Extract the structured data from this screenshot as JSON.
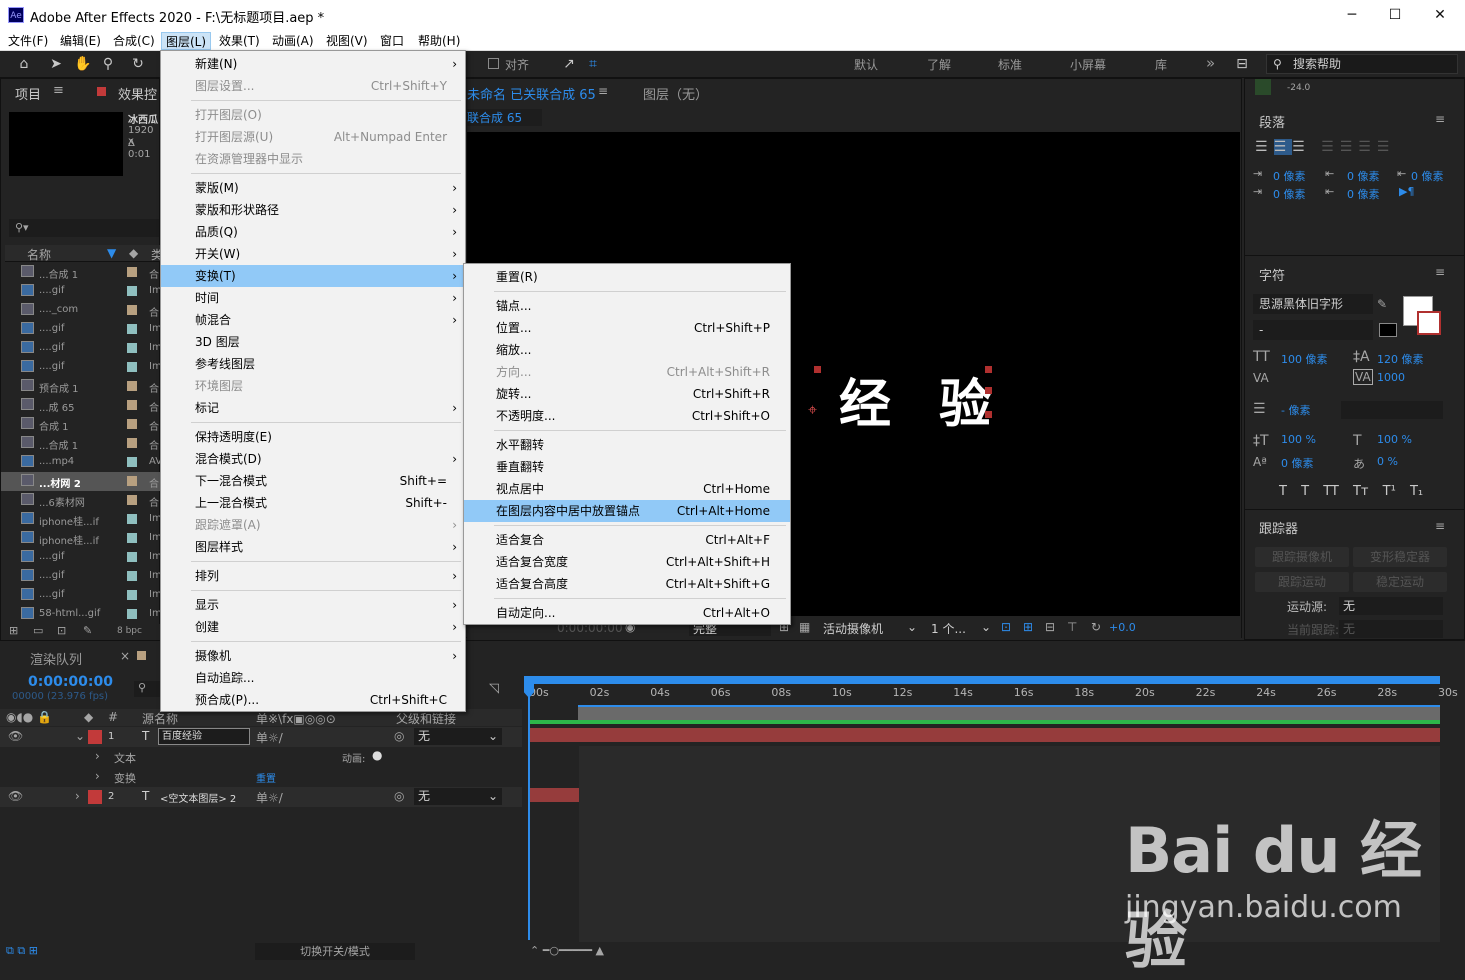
{
  "window": {
    "title": "Adobe After Effects 2020 - F:\\无标题项目.aep *",
    "app_icon": "Ae",
    "controls": {
      "minimize": "─",
      "maximize": "☐",
      "close": "✕"
    }
  },
  "menubar": [
    "文件(F)",
    "编辑(E)",
    "合成(C)",
    "图层(L)",
    "效果(T)",
    "动画(A)",
    "视图(V)",
    "窗口",
    "帮助(H)"
  ],
  "toolbar": {
    "align_label": "对齐",
    "workspaces": [
      "默认",
      "了解",
      "标准",
      "小屏幕",
      "库"
    ],
    "more": "»",
    "search_placeholder": "搜索帮助"
  },
  "project_panel": {
    "title": "项目",
    "effects_tab": "效果控",
    "comp_name": "冰西瓜",
    "comp_size": "1920 x",
    "comp_duration": "Δ 0:01",
    "col_name": "名称",
    "col_type": "类",
    "items": [
      {
        "name": "...合成 1",
        "type": "合"
      },
      {
        "name": "....gif",
        "type": "Im"
      },
      {
        "name": "...._com",
        "type": "合"
      },
      {
        "name": "....gif",
        "type": "Im"
      },
      {
        "name": "....gif",
        "type": "Im"
      },
      {
        "name": "....gif",
        "type": "Im"
      },
      {
        "name": "预合成 1",
        "type": "合"
      },
      {
        "name": "...成 65",
        "type": "合"
      },
      {
        "name": "合成 1",
        "type": "合"
      },
      {
        "name": "...合成 1",
        "type": "合"
      },
      {
        "name": "....mp4",
        "type": "AV"
      },
      {
        "name": "...材网 2",
        "type": "合"
      },
      {
        "name": "...6素材网",
        "type": "合"
      },
      {
        "name": "iphone桂...if",
        "type": "Im"
      },
      {
        "name": "iphone桂...if",
        "type": "Im"
      },
      {
        "name": "....gif",
        "type": "Im"
      },
      {
        "name": "....gif",
        "type": "Im"
      },
      {
        "name": "....gif",
        "type": "Im"
      },
      {
        "name": "58-html...gif",
        "type": "Im"
      }
    ],
    "bpc": "8 bpc"
  },
  "comp_panel": {
    "tab": "未命名 已关联合成 65",
    "layer_tab": "图层（无）",
    "sub_tab": "联合成 65",
    "canvas_text": [
      "经",
      "验"
    ],
    "bottom": {
      "timecode": "0:00:00:00",
      "quality": "完整",
      "camera": "活动摄像机",
      "views": "1 个...",
      "exposure": "+0.0"
    }
  },
  "right_panel": {
    "paragraph": {
      "title": "段落",
      "top_value": "-24.0",
      "indent_values": [
        "0 像素",
        "0 像素",
        "0 像素",
        "0 像素",
        "0 像素"
      ]
    },
    "character": {
      "title": "字符",
      "font": "思源黑体旧字形",
      "style": "-",
      "size": "100 像素",
      "leading": "120 像素",
      "kerning": "",
      "tracking": "1000",
      "stroke_width": "- 像素",
      "vscale": "100 %",
      "hscale": "100 %",
      "baseline": "0 像素",
      "tsume": "0 %",
      "styles": [
        "T",
        "T",
        "TT",
        "Tт",
        "T¹",
        "T₁"
      ]
    },
    "tracker": {
      "title": "跟踪器",
      "buttons": [
        "跟踪摄像机",
        "变形稳定器",
        "跟踪运动",
        "稳定运动"
      ],
      "motion_source_label": "运动源:",
      "motion_source": "无",
      "current_track_label": "当前跟踪:",
      "current_track": "无"
    }
  },
  "timeline": {
    "render_queue": "渲染队列",
    "timecode": "0:00:00:00",
    "fps": "00000 (23.976 fps)",
    "col_source": "源名称",
    "col_parent": "父级和链接",
    "layers": [
      {
        "num": "1",
        "type": "T",
        "name": "百度经验",
        "parent": "无"
      },
      {
        "num": "2",
        "type": "T",
        "name": "<空文本图层> 2",
        "parent": "无"
      }
    ],
    "props": [
      {
        "name": "文本",
        "extra": "动画:"
      },
      {
        "name": "变换",
        "extra": "重置"
      }
    ],
    "ticks": [
      "00s",
      "02s",
      "04s",
      "06s",
      "08s",
      "10s",
      "12s",
      "14s",
      "16s",
      "18s",
      "20s",
      "22s",
      "24s",
      "26s",
      "28s",
      "30s"
    ],
    "footer": "切换开关/模式"
  },
  "layer_menu": {
    "items": [
      {
        "label": "新建(N)",
        "shortcut": "",
        "arrow": true,
        "disabled": false
      },
      {
        "label": "图层设置...",
        "shortcut": "Ctrl+Shift+Y",
        "arrow": false,
        "disabled": true
      },
      {
        "label": "打开图层(O)",
        "shortcut": "",
        "arrow": false,
        "disabled": true
      },
      {
        "label": "打开图层源(U)",
        "shortcut": "Alt+Numpad Enter",
        "arrow": false,
        "disabled": true
      },
      {
        "label": "在资源管理器中显示",
        "shortcut": "",
        "arrow": false,
        "disabled": true
      },
      {
        "label": "蒙版(M)",
        "shortcut": "",
        "arrow": true,
        "disabled": false
      },
      {
        "label": "蒙版和形状路径",
        "shortcut": "",
        "arrow": true,
        "disabled": false
      },
      {
        "label": "品质(Q)",
        "shortcut": "",
        "arrow": true,
        "disabled": false
      },
      {
        "label": "开关(W)",
        "shortcut": "",
        "arrow": true,
        "disabled": false
      },
      {
        "label": "变换(T)",
        "shortcut": "",
        "arrow": true,
        "disabled": false
      },
      {
        "label": "时间",
        "shortcut": "",
        "arrow": true,
        "disabled": false
      },
      {
        "label": "帧混合",
        "shortcut": "",
        "arrow": true,
        "disabled": false
      },
      {
        "label": "3D 图层",
        "shortcut": "",
        "arrow": false,
        "disabled": false
      },
      {
        "label": "参考线图层",
        "shortcut": "",
        "arrow": false,
        "disabled": false
      },
      {
        "label": "环境图层",
        "shortcut": "",
        "arrow": false,
        "disabled": true
      },
      {
        "label": "标记",
        "shortcut": "",
        "arrow": true,
        "disabled": false
      },
      {
        "label": "保持透明度(E)",
        "shortcut": "",
        "arrow": false,
        "disabled": false
      },
      {
        "label": "混合模式(D)",
        "shortcut": "",
        "arrow": true,
        "disabled": false
      },
      {
        "label": "下一混合模式",
        "shortcut": "Shift+=",
        "arrow": false,
        "disabled": false
      },
      {
        "label": "上一混合模式",
        "shortcut": "Shift+-",
        "arrow": false,
        "disabled": false
      },
      {
        "label": "跟踪遮罩(A)",
        "shortcut": "",
        "arrow": true,
        "disabled": true
      },
      {
        "label": "图层样式",
        "shortcut": "",
        "arrow": true,
        "disabled": false
      },
      {
        "label": "排列",
        "shortcut": "",
        "arrow": true,
        "disabled": false
      },
      {
        "label": "显示",
        "shortcut": "",
        "arrow": true,
        "disabled": false
      },
      {
        "label": "创建",
        "shortcut": "",
        "arrow": true,
        "disabled": false
      },
      {
        "label": "摄像机",
        "shortcut": "",
        "arrow": true,
        "disabled": false
      },
      {
        "label": "自动追踪...",
        "shortcut": "",
        "arrow": false,
        "disabled": false
      },
      {
        "label": "预合成(P)...",
        "shortcut": "Ctrl+Shift+C",
        "arrow": false,
        "disabled": false
      }
    ]
  },
  "transform_submenu": {
    "items": [
      {
        "label": "重置(R)",
        "shortcut": "",
        "disabled": false
      },
      {
        "label": "锚点...",
        "shortcut": "",
        "disabled": false
      },
      {
        "label": "位置...",
        "shortcut": "Ctrl+Shift+P",
        "disabled": false
      },
      {
        "label": "缩放...",
        "shortcut": "",
        "disabled": false
      },
      {
        "label": "方向...",
        "shortcut": "Ctrl+Alt+Shift+R",
        "disabled": true
      },
      {
        "label": "旋转...",
        "shortcut": "Ctrl+Shift+R",
        "disabled": false
      },
      {
        "label": "不透明度...",
        "shortcut": "Ctrl+Shift+O",
        "disabled": false
      },
      {
        "label": "水平翻转",
        "shortcut": "",
        "disabled": false
      },
      {
        "label": "垂直翻转",
        "shortcut": "",
        "disabled": false
      },
      {
        "label": "视点居中",
        "shortcut": "Ctrl+Home",
        "disabled": false
      },
      {
        "label": "在图层内容中居中放置锚点",
        "shortcut": "Ctrl+Alt+Home",
        "disabled": false
      },
      {
        "label": "适合复合",
        "shortcut": "Ctrl+Alt+F",
        "disabled": false
      },
      {
        "label": "适合复合宽度",
        "shortcut": "Ctrl+Alt+Shift+H",
        "disabled": false
      },
      {
        "label": "适合复合高度",
        "shortcut": "Ctrl+Alt+Shift+G",
        "disabled": false
      },
      {
        "label": "自动定向...",
        "shortcut": "Ctrl+Alt+O",
        "disabled": false
      }
    ]
  },
  "watermark": {
    "brand": "Bai du 经验",
    "url": "jingyan.baidu.com"
  },
  "colors": {
    "accent": "#2d8ceb",
    "layer_red": "#963c3c",
    "menu_highlight": "#91c9f7"
  }
}
